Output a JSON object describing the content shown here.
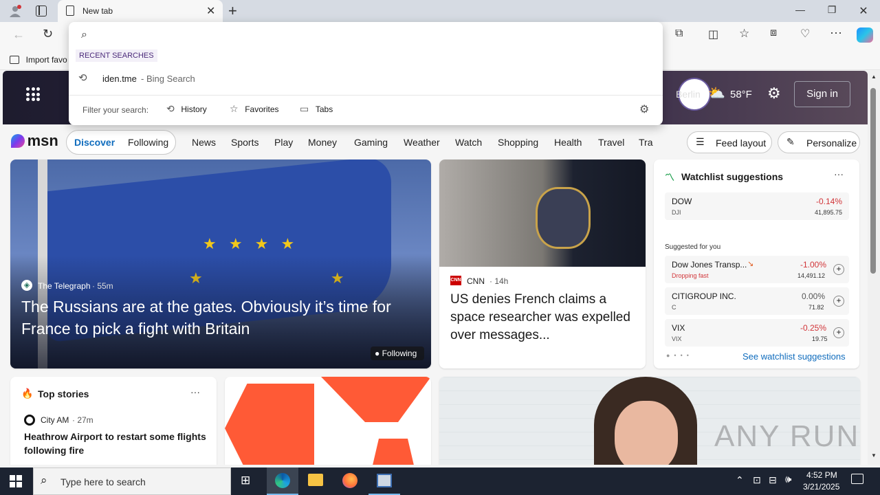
{
  "browser": {
    "tab_title": "New tab",
    "favorites_label": "Import favo"
  },
  "omnibox": {
    "query": "",
    "recent_label": "RECENT SEARCHES",
    "recent_item": "iden.tme",
    "recent_suffix": " - Bing Search",
    "filter_label": "Filter your search:",
    "filters": [
      "History",
      "Favorites",
      "Tabs"
    ]
  },
  "header": {
    "location": "Berlin",
    "temperature": "58°F",
    "sign_in": "Sign in"
  },
  "nav": {
    "logo": "msn",
    "discover": "Discover",
    "following": "Following",
    "items": [
      "News",
      "Sports",
      "Play",
      "Money",
      "Gaming",
      "Weather",
      "Watch",
      "Shopping",
      "Health",
      "Travel",
      "Tra"
    ],
    "feed_layout": "Feed layout",
    "personalize": "Personalize"
  },
  "hero": {
    "source": "The Telegraph",
    "time": "· 55m",
    "headline": "The Russians are at the gates. Obviously it’s time for France to pick a fight with Britain",
    "following_badge": "Following"
  },
  "cnn": {
    "source": "CNN",
    "time": "· 14h",
    "headline": "US denies French claims a space researcher was expelled over messages..."
  },
  "watchlist": {
    "title": "Watchlist suggestions",
    "suggested_label": "Suggested for you",
    "see_more": "See watchlist suggestions",
    "colors": {
      "negative": "#d13438",
      "neutral": "#555555"
    },
    "main": {
      "name": "DOW",
      "symbol": "DJI",
      "change": "-0.14%",
      "value": "41,895.75"
    },
    "suggested": [
      {
        "name": "Dow Jones Transp...",
        "symbol": "Dropping fast",
        "change": "-1.00%",
        "value": "14,491.12"
      },
      {
        "name": "CITIGROUP INC.",
        "symbol": "C",
        "change": "0.00%",
        "value": "71.82"
      },
      {
        "name": "VIX",
        "symbol": "VIX",
        "change": "-0.25%",
        "value": "19.75"
      }
    ]
  },
  "top_stories": {
    "title": "Top stories",
    "source": "City AM",
    "time": "· 27m",
    "headline": "Heathrow Airport to restart some flights following fire"
  },
  "watermark": "ANY RUN",
  "taskbar": {
    "search_placeholder": "Type here to search",
    "time": "4:52 PM",
    "date": "3/21/2025"
  }
}
